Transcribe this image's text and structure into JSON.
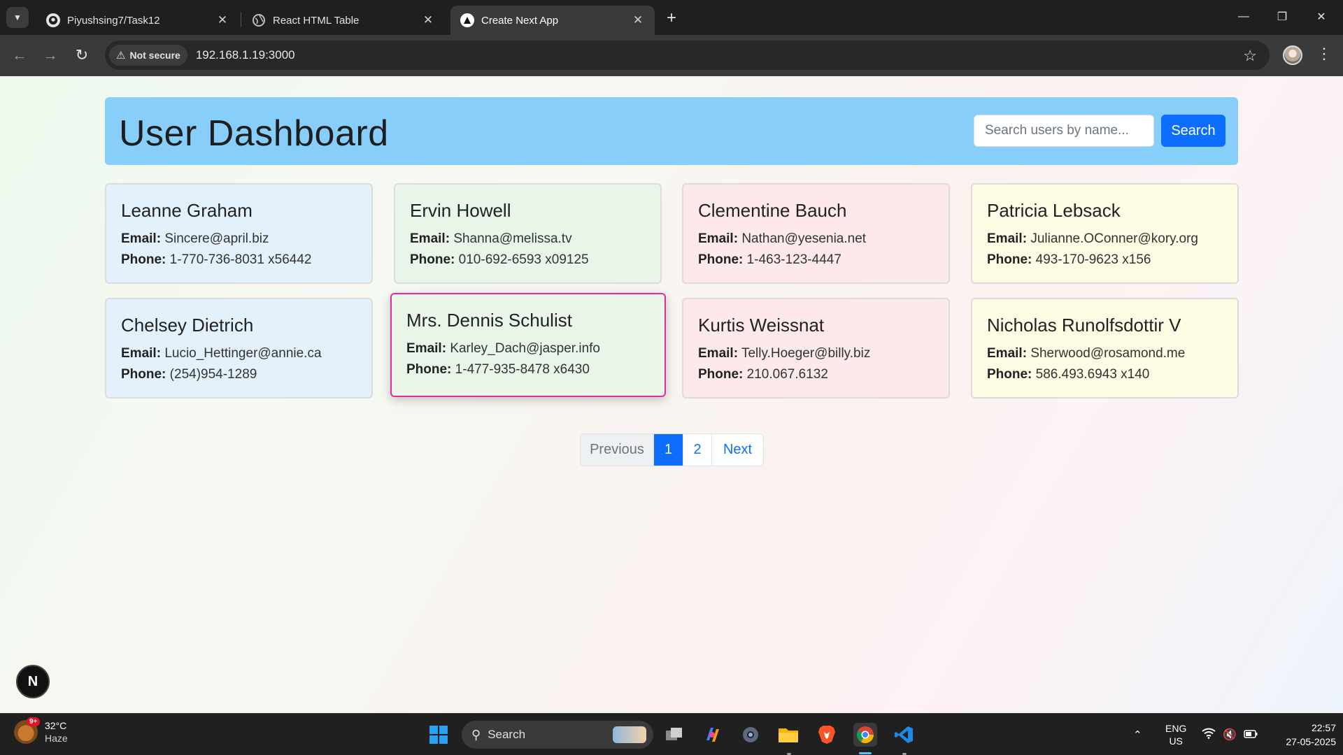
{
  "browser": {
    "tabs": [
      {
        "title": "Piyushsing7/Task12",
        "icon": "github-icon",
        "active": false
      },
      {
        "title": "React HTML Table",
        "icon": "globe-icon",
        "active": false
      },
      {
        "title": "Create Next App",
        "icon": "nextjs-triangle-icon",
        "active": true
      }
    ],
    "security_label": "Not secure",
    "url": "192.168.1.19:3000"
  },
  "page": {
    "title": "User Dashboard",
    "search": {
      "placeholder": "Search users by name...",
      "value": "",
      "button_label": "Search"
    },
    "email_label": "Email:",
    "phone_label": "Phone:",
    "users": [
      {
        "name": "Leanne Graham",
        "email": "Sincere@april.biz",
        "phone": "1-770-736-8031 x56442",
        "color": "#e3f1fd"
      },
      {
        "name": "Ervin Howell",
        "email": "Shanna@melissa.tv",
        "phone": "010-692-6593 x09125",
        "color": "#e9f5e8"
      },
      {
        "name": "Clementine Bauch",
        "email": "Nathan@yesenia.net",
        "phone": "1-463-123-4447",
        "color": "#fde8ec"
      },
      {
        "name": "Patricia Lebsack",
        "email": "Julianne.OConner@kory.org",
        "phone": "493-170-9623 x156",
        "color": "#fefbe5"
      },
      {
        "name": "Chelsey Dietrich",
        "email": "Lucio_Hettinger@annie.ca",
        "phone": "(254)954-1289",
        "color": "#e3f1fd"
      },
      {
        "name": "Mrs. Dennis Schulist",
        "email": "Karley_Dach@jasper.info",
        "phone": "1-477-935-8478 x6430",
        "color": "#e9f5e8",
        "highlighted": true
      },
      {
        "name": "Kurtis Weissnat",
        "email": "Telly.Hoeger@billy.biz",
        "phone": "210.067.6132",
        "color": "#fde8ec"
      },
      {
        "name": "Nicholas Runolfsdottir V",
        "email": "Sherwood@rosamond.me",
        "phone": "586.493.6943 x140",
        "color": "#fefbe5"
      }
    ],
    "pagination": {
      "previous": "Previous",
      "pages": [
        "1",
        "2"
      ],
      "current_page": "1",
      "next": "Next"
    },
    "dev_badge": "N"
  },
  "taskbar": {
    "weather": {
      "temp": "32°C",
      "condition": "Haze",
      "badge": "9+"
    },
    "search_label": "Search",
    "language": {
      "line1": "ENG",
      "line2": "US"
    },
    "time": "22:57",
    "date": "27-05-2025"
  },
  "colors": {
    "header_bg": "#87cefa",
    "accent": "#0d6efd",
    "highlight_border": "#e6299f"
  }
}
